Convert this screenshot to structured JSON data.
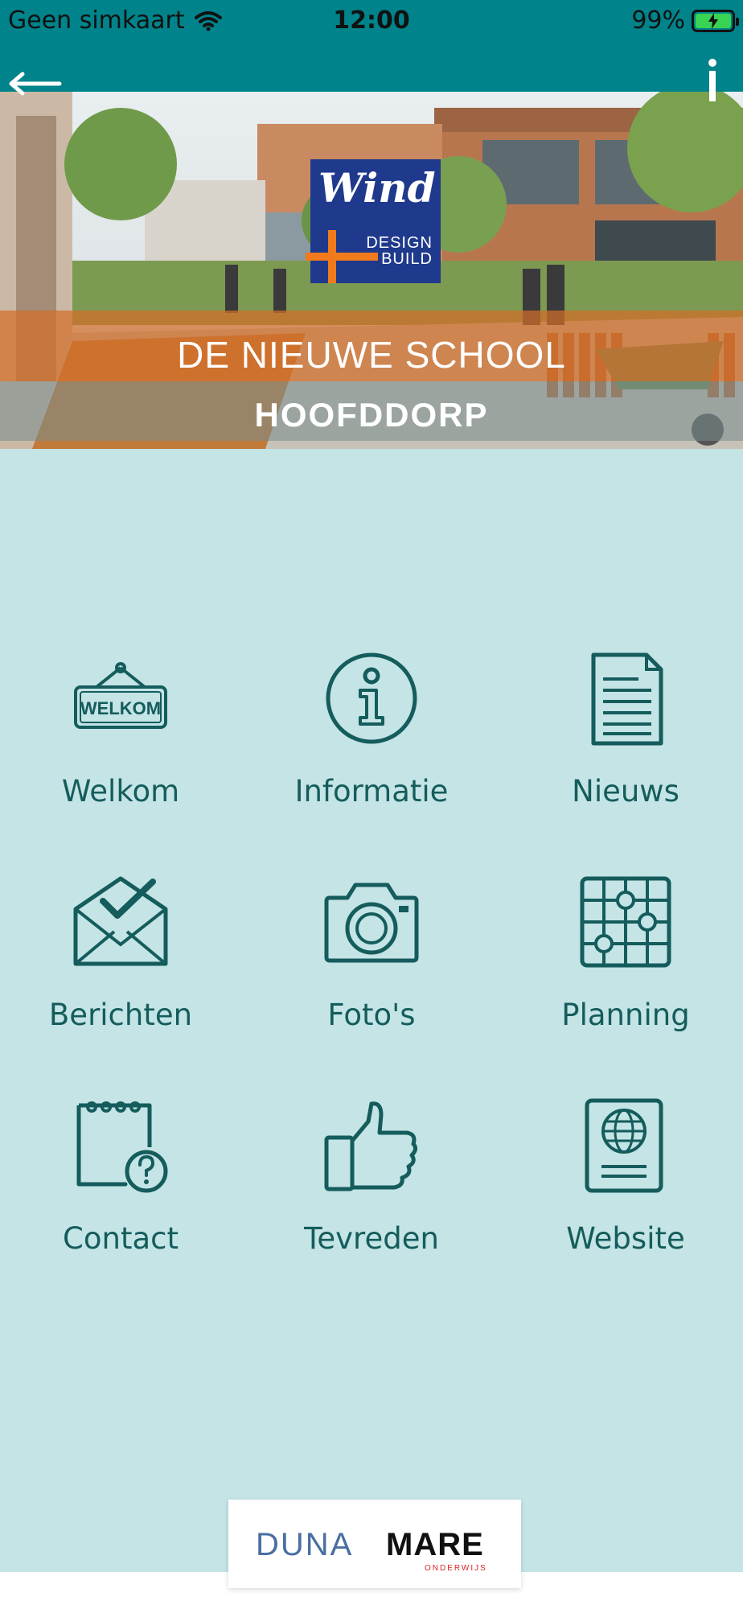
{
  "status_bar": {
    "carrier": "Geen simkaart",
    "time": "12:00",
    "battery": "99%"
  },
  "header": {
    "back_icon": "arrow-left-icon",
    "info_icon": "info-i-icon"
  },
  "hero": {
    "logo_name": "Wind",
    "logo_design": "DESIGN",
    "logo_build": "BUILD",
    "title": "DE NIEUWE SCHOOL",
    "subtitle": "HOOFDDORP"
  },
  "menu": [
    {
      "label": "Welkom",
      "icon": "welkom-sign-icon",
      "sign_text": "WELKOM"
    },
    {
      "label": "Informatie",
      "icon": "info-circle-icon"
    },
    {
      "label": "Nieuws",
      "icon": "document-icon"
    },
    {
      "label": "Berichten",
      "icon": "envelope-check-icon"
    },
    {
      "label": "Foto's",
      "icon": "camera-icon"
    },
    {
      "label": "Planning",
      "icon": "planning-grid-icon"
    },
    {
      "label": "Contact",
      "icon": "notepad-question-icon"
    },
    {
      "label": "Tevreden",
      "icon": "thumbs-up-icon"
    },
    {
      "label": "Website",
      "icon": "globe-book-icon"
    }
  ],
  "footer": {
    "logo_part1": "DUNA",
    "logo_part2": "MARE",
    "logo_sub": "ONDERWIJS"
  },
  "colors": {
    "topbar": "#00838a",
    "background": "#c4e4e6",
    "icon": "#155c5c",
    "banner_orange": "#d26e28"
  }
}
